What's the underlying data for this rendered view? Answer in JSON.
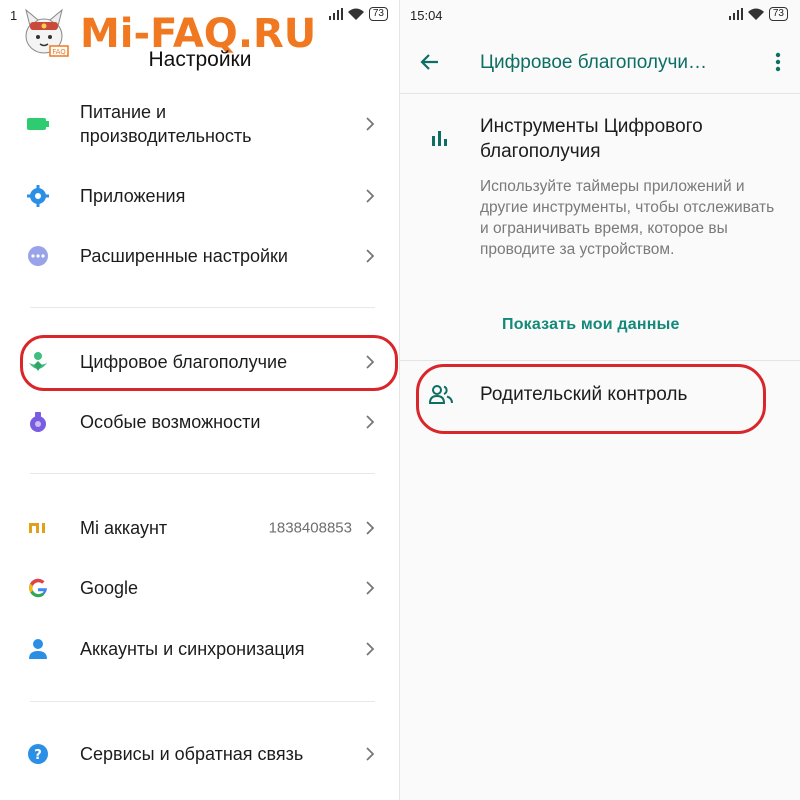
{
  "watermark": {
    "text": "Mi-FAQ.RU",
    "badge": "FAQ"
  },
  "left": {
    "status": {
      "time": "1",
      "battery": "73"
    },
    "title": "Настройки",
    "items": [
      {
        "label": "Питание и",
        "label2": "производительность",
        "icon": "battery-icon",
        "icon_color": "#2ecc71"
      },
      {
        "label": "Приложения",
        "icon": "gear-icon",
        "icon_color": "#2b8fe6"
      },
      {
        "label": "Расширенные настройки",
        "icon": "more-dots-icon",
        "icon_color": "#9aa3e8"
      },
      {
        "label": "Цифровое благополучие",
        "icon": "wellbeing-icon",
        "icon_color": "#3fbf7f"
      },
      {
        "label": "Особые возможности",
        "icon": "accessibility-icon",
        "icon_color": "#7a5ce0"
      },
      {
        "label": "Mi аккаунт",
        "value": "1838408853",
        "icon": "mi-icon",
        "icon_color": "#e0a11b"
      },
      {
        "label": "Google",
        "icon": "google-icon"
      },
      {
        "label": "Аккаунты и синхронизация",
        "icon": "account-icon",
        "icon_color": "#2b8fe6"
      },
      {
        "label": "Сервисы и обратная связь",
        "icon": "help-icon",
        "icon_color": "#2b8fe6"
      }
    ]
  },
  "right": {
    "status": {
      "time": "15:04",
      "battery": "73"
    },
    "appbar_title": "Цифровое благополучи…",
    "tools_title": "Инструменты Цифрового благополучия",
    "tools_desc": "Используйте таймеры приложений и другие инструменты, чтобы отслеживать и ограничивать время, которое вы проводите за устройством.",
    "show_data": "Показать мои данные",
    "parental": "Родительский контроль"
  },
  "colors": {
    "accent_teal": "#0d6e64",
    "link_teal": "#14897a",
    "highlight_red": "#d9262b",
    "watermark_orange": "#f07820"
  }
}
